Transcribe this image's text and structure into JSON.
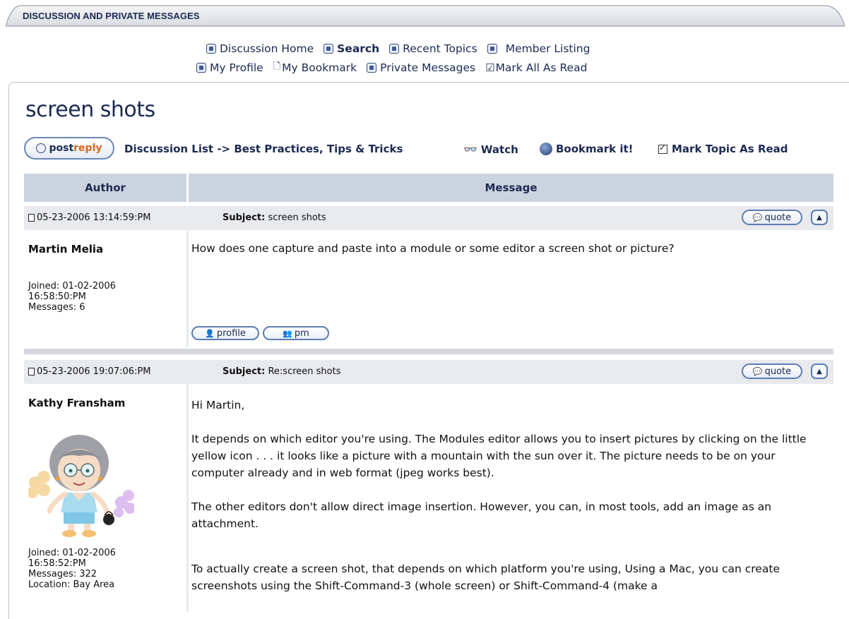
{
  "header": {
    "title": "DISCUSSION AND PRIVATE MESSAGES"
  },
  "nav": {
    "row1": [
      {
        "label": "Discussion Home",
        "icon": "home-icon"
      },
      {
        "label": "Search",
        "icon": "search-icon"
      },
      {
        "label": "Recent Topics",
        "icon": "recent-topics-icon"
      },
      {
        "label": "Member Listing",
        "icon": "member-listing-icon"
      }
    ],
    "row2": [
      {
        "label": "My Profile",
        "icon": "profile-icon"
      },
      {
        "label": "My Bookmark",
        "icon": "bookmark-icon"
      },
      {
        "label": "Private Messages",
        "icon": "private-messages-icon"
      },
      {
        "label": "Mark All As Read",
        "icon": "checkbox-icon"
      }
    ]
  },
  "page": {
    "title": "screen shots"
  },
  "toolbar": {
    "postreply_part1": "post",
    "postreply_part2": "reply",
    "breadcrumb": "Discussion List -> Best Practices, Tips & Tricks",
    "watch": "Watch",
    "bookmark": "Bookmark it!",
    "mark_topic_read": "Mark Topic As Read"
  },
  "table": {
    "col_author": "Author",
    "col_message": "Message"
  },
  "buttons": {
    "quote": "quote",
    "profile": "profile",
    "pm": "pm"
  },
  "posts": [
    {
      "date": "05-23-2006 13:14:59:PM",
      "subject_label": "Subject:",
      "subject": "screen shots",
      "author": "Martin Melia",
      "joined_line1": "Joined: 01-02-2006",
      "joined_line2": "16:58:50:PM",
      "messages": "Messages: 6",
      "body": [
        "How does one capture and paste into a module or some editor a screen shot or picture?"
      ]
    },
    {
      "date": "05-23-2006 19:07:06:PM",
      "subject_label": "Subject:",
      "subject": "Re:screen shots",
      "author": "Kathy Fransham",
      "joined_line1": "Joined: 01-02-2006",
      "joined_line2": "16:58:52:PM",
      "messages": "Messages: 322",
      "location": "Location: Bay Area",
      "body": [
        "Hi Martin,",
        "It depends on which editor you're using. The Modules editor allows you to insert pictures by clicking on the little yellow icon  . . . it looks like a picture with a mountain with the sun over it. The picture needs to be on your computer already and in web format (jpeg works best).",
        "The other editors don't allow direct image insertion.  However, you can, in most tools, add an image as an attachment.",
        "To actually create a screen shot, that depends on which platform you're using, Using a Mac, you can create screenshots using the Shift-Command-3 (whole screen) or Shift-Command-4 (make a"
      ]
    }
  ],
  "colors": {
    "navy": "#1c2a52",
    "accent": "#d06a20",
    "header_bar": "#cbd3de",
    "post_bar": "#e8eaed"
  }
}
